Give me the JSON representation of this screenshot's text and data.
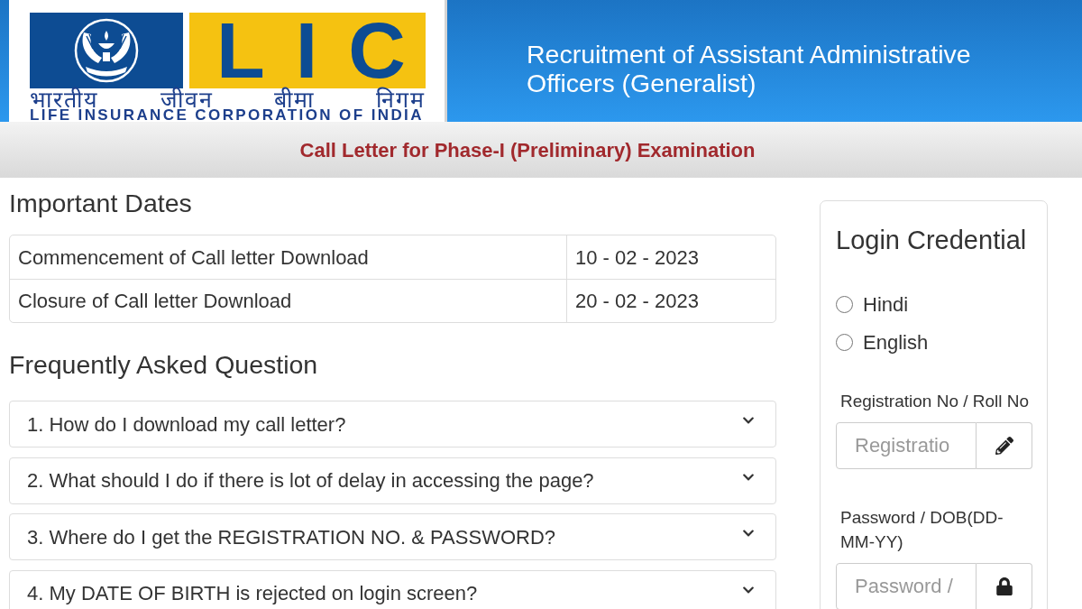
{
  "header": {
    "logo": {
      "letters": "LIC",
      "hindi_name": "भारतीय जीवन बीमा निगम",
      "english_name": "LIFE INSURANCE CORPORATION OF INDIA"
    },
    "title": "Recruitment of Assistant Administrative Officers (Generalist)"
  },
  "banner": {
    "title": "Call Letter for Phase-I (Preliminary) Examination"
  },
  "important_dates": {
    "heading": "Important Dates",
    "rows": [
      {
        "event": "Commencement of Call letter Download",
        "date": "10 - 02 - 2023"
      },
      {
        "event": "Closure of Call letter Download",
        "date": "20 - 02 - 2023"
      }
    ]
  },
  "faq": {
    "heading": "Frequently Asked Question",
    "items": [
      {
        "question": "1. How do I download my call letter?",
        "expanded": false
      },
      {
        "question": "2. What should I do if there is lot of delay in accessing the page?",
        "expanded": false
      },
      {
        "question": "3. Where do I get the REGISTRATION NO. & PASSWORD?",
        "expanded": false
      },
      {
        "question": "4. My DATE OF BIRTH is rejected on login screen?",
        "expanded": false
      }
    ]
  },
  "login": {
    "heading": "Login Credential",
    "languages": [
      {
        "label": "Hindi",
        "selected": false
      },
      {
        "label": "English",
        "selected": false
      }
    ],
    "fields": [
      {
        "kind": "text",
        "label": "Registration No / Roll No",
        "placeholder": "Registratio"
      },
      {
        "kind": "password",
        "label": "Password / DOB(DD-MM-YY)",
        "placeholder": "Password /"
      }
    ]
  }
}
